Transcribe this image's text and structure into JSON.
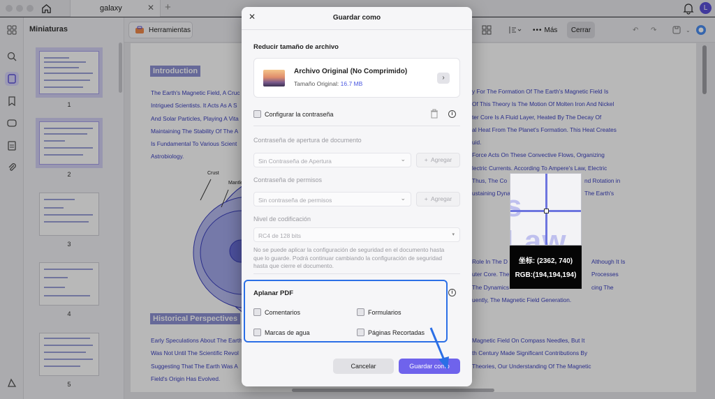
{
  "tab": {
    "title": "galaxy"
  },
  "user": {
    "avatar_initial": "L"
  },
  "thumbnails": {
    "title": "Miniaturas",
    "pages": [
      "1",
      "2",
      "3",
      "4",
      "5"
    ]
  },
  "toolbar": {
    "tools_label": "Herramientas",
    "more_label": "Más",
    "close_label": "Cerrar"
  },
  "document": {
    "intro_heading": "Introduction",
    "intro_left": [
      "The Earth's Magnetic Field, A Cruc",
      "Intrigued Scientists. It Acts As A S",
      "And Solar Particles, Playing A Vita",
      "Maintaining The Stability Of The A",
      "Is Fundamental To Various Scient",
      "Astrobiology."
    ],
    "intro_right": [
      "y For The Formation Of The Earth's Magnetic Field Is",
      "Of This Theory Is The Motion Of Molten Iron And Nickel",
      "ter Core Is A Fluid Layer, Heated By The Decay Of",
      "al Heat From The Planet's Formation. This Heat Creates",
      "uid.",
      "Force Acts On These Convective Flows, Organizing",
      "lectric Currents. According To Ampere's Law, Electric",
      "Thus, The Co",
      "ustaining Dyna"
    ],
    "intro_right_tail": [
      "nd Rotation in",
      "The Earth's"
    ],
    "mid_right": [
      "Role In The D",
      "uter Core. The",
      "The Dynamics",
      "uently, The Magnetic Field Generation."
    ],
    "mid_right_tail": [
      "Although It Is",
      "Processes",
      "cing The"
    ],
    "diagram_labels": {
      "crust": "Crust",
      "mantle": "Mantle",
      "outer": "O"
    },
    "history_heading": "Historical Perspectives",
    "history_left": [
      "Early Speculations About The Earth",
      "Was Not Until The Scientific Revol",
      "Suggesting That The Earth Was A",
      "Field's Origin Has Evolved."
    ],
    "history_right": [
      "Magnetic Field On Compass Needles, But It",
      "th Century Made Significant Contributions By",
      "Theories, Our Understanding Of The Magnetic"
    ]
  },
  "magnifier": {
    "text": "s Law",
    "coords": "坐标: (2362, 740)",
    "rgb": "RGB:(194,194,194)"
  },
  "dialog": {
    "title": "Guardar como",
    "reduce_section": "Reducir tamaño de archivo",
    "file_name": "Archivo Original (No Comprimido)",
    "file_size_label": "Tamaño Original:",
    "file_size_value": "16.7 MB",
    "configure_password": "Configurar la contraseña",
    "open_password_label": "Contraseña de apertura de documento",
    "open_password_placeholder": "Sin Contraseña de Apertura",
    "permission_password_label": "Contraseña de permisos",
    "permission_password_placeholder": "Sin contraseña de permisos",
    "add_label": "Agregar",
    "encryption_label": "Nivel de codificación",
    "encryption_value": "RC4 de 128 bits",
    "note_lines": [
      "No se puede aplicar la configuración de seguridad en el documento hasta",
      "que lo guarde. Podrá continuar cambiando la configuración de seguridad",
      "hasta que cierre el documento."
    ],
    "flatten_title": "Aplanar PDF",
    "flatten_options": {
      "comments": "Comentarios",
      "forms": "Formularios",
      "watermarks": "Marcas de agua",
      "cropped_pages": "Páginas Recortadas"
    },
    "cancel_label": "Cancelar",
    "save_label": "Guardar como"
  },
  "colors": {
    "accent": "#6f63ec",
    "highlight_box": "#2b6fe6",
    "doc_text": "#3a3fc0"
  }
}
